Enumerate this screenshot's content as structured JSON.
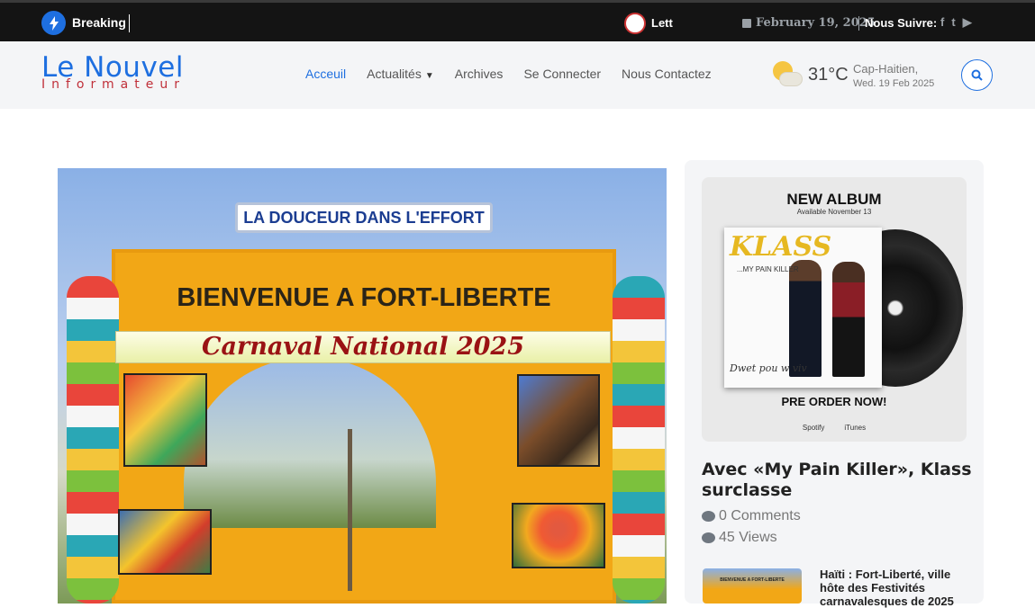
{
  "topbar": {
    "breaking_label": "Breaking",
    "ticker_text": "Lett",
    "date": "February 19, 2025",
    "follow_label": "Nous Suivre:",
    "social": [
      "f",
      "t",
      "▶"
    ]
  },
  "header": {
    "logo_main": "Le Nouvel",
    "logo_sub": "Informateur",
    "nav": [
      "Acceuil",
      "Actualités",
      "Archives",
      "Se Connecter",
      "Nous Contactez"
    ],
    "weather": {
      "temp": "31°C",
      "city": "Cap-Haitien,",
      "date": "Wed. 19 Feb 2025"
    }
  },
  "hero": {
    "sign_top": "LA DOUCEUR DANS L'EFFORT",
    "welcome": "BIENVENUE A FORT-LIBERTE",
    "carnaval": "Carnaval National 2025"
  },
  "sidebar": {
    "ad": {
      "title": "NEW ALBUM",
      "available": "Available November 13",
      "artist": "KLASS",
      "album": "...MY PAIN KILLER",
      "script": "Dwet pou w viv",
      "preorder": "PRE ORDER NOW!",
      "stores": [
        "Spotify",
        "iTunes"
      ]
    },
    "post": {
      "title": "Avec «My Pain Killer», Klass surclasse",
      "comments": "0 Comments",
      "views": "45 Views"
    },
    "related": {
      "thumb_text": "BIENVENUE A FORT-LIBERTE",
      "title": "Haïti : Fort-Liberté, ville hôte des Festivités carnavalesques de 2025"
    }
  },
  "colors": {
    "accent": "#1e6fe0",
    "logo_sub": "#c0303a",
    "topbar_bg": "#141414"
  }
}
